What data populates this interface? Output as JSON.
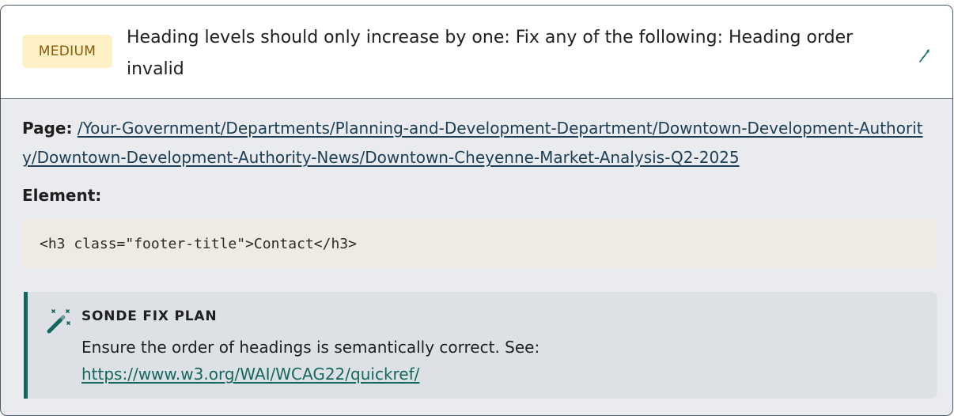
{
  "issue": {
    "severity": "MEDIUM",
    "title": "Heading levels should only increase by one: Fix any of the following: Heading order invalid",
    "icons": {
      "edit": "pen-icon",
      "fix": "magic-wand-icon"
    }
  },
  "details": {
    "page_label": "Page:",
    "page_url": "/Your-Government/Departments/Planning-and-Development-Department/Downtown-Development-Authority/Downtown-Development-Authority-News/Downtown-Cheyenne-Market-Analysis-Q2-2025",
    "element_label": "Element:",
    "element_code": "<h3 class=\"footer-title\">Contact</h3>"
  },
  "fix_plan": {
    "title": "SONDE FIX PLAN",
    "text": "Ensure the order of headings is semantically correct. See:",
    "link": "https://www.w3.org/WAI/WCAG22/quickref/"
  },
  "colors": {
    "badge_bg": "#fdf0c4",
    "badge_text": "#8a5a0c",
    "accent": "#14675f",
    "link": "#1c3f55"
  }
}
